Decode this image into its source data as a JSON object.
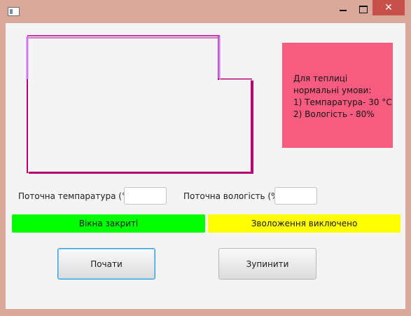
{
  "window": {
    "title": "",
    "close_glyph": "✕"
  },
  "info": {
    "lines": [
      "Для теплиці",
      "нормальні умови:",
      "1) Темпаратура- 30 °C",
      "2) Вологість - 80%"
    ]
  },
  "temperature": {
    "label": "Поточна темпаратура (°C)",
    "value": ""
  },
  "humidity": {
    "label": "Поточна вологість (%)",
    "value": ""
  },
  "status": {
    "windows_text": "Вікна закриті",
    "windows_color": "#00ff00",
    "humidifier_text": "Зволоження виключено",
    "humidifier_color": "#ffff00"
  },
  "buttons": {
    "start_label": "Почати",
    "stop_label": "Зупинити"
  },
  "colors": {
    "room_outline": "#b5006f",
    "window_open_highlight": "#cc77ee",
    "info_box": "#f75b7f"
  }
}
